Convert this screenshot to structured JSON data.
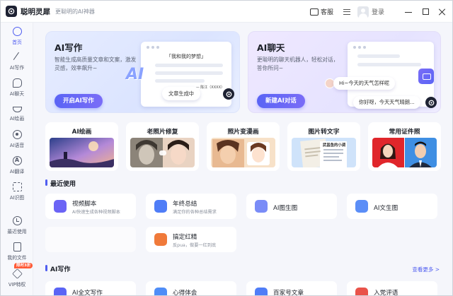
{
  "titlebar": {
    "app_name": "聪明灵犀",
    "slogan": "更聪明的AI神器",
    "service_label": "客服",
    "login_label": "登录"
  },
  "sidebar": {
    "items": [
      {
        "label": "首页",
        "icon": "home-icon",
        "active": true
      },
      {
        "label": "AI写作",
        "icon": "pen-icon"
      },
      {
        "label": "AI聊天",
        "icon": "chat-icon"
      },
      {
        "label": "AI绘画",
        "icon": "brush-icon"
      },
      {
        "label": "AI语音",
        "icon": "voice-icon"
      },
      {
        "label": "AI翻译",
        "icon": "translate-icon"
      },
      {
        "label": "AI识图",
        "icon": "scan-icon"
      },
      {
        "label": "最近使用",
        "icon": "clock-icon"
      },
      {
        "label": "我的文件",
        "icon": "file-icon"
      },
      {
        "label": "VIP特权",
        "icon": "vip-icon"
      }
    ],
    "vip_badge": "限时3折"
  },
  "hero": {
    "write": {
      "title": "AI写作",
      "desc": "智能生成高质量文章和文案，激发灵感，效率飙升~",
      "button": "开启AI写作",
      "mock_title": "「我和我的梦想」",
      "mock_author": "—— 陈江（XXXX）",
      "ai_text": "AI",
      "status": "文章生成中"
    },
    "chat": {
      "title": "AI聊天",
      "desc": "更聪明的聊天机器人，轻松对话，答你所问~",
      "button": "新建AI对话",
      "bubble_user": "Hi~今天的天气怎样呢",
      "bubble_bot": "你好呀，今天天气晴朗..."
    }
  },
  "tools": [
    {
      "label": "AI绘画"
    },
    {
      "label": "老照片修复"
    },
    {
      "label": "照片变漫画"
    },
    {
      "label": "图片转文字",
      "doc_title": "武昌鱼的小调"
    },
    {
      "label": "常用证件照"
    }
  ],
  "recent": {
    "title": "最近使用",
    "items": [
      {
        "title": "视频脚本",
        "sub": "AI快速生成各种视频脚本",
        "color": "#6b64f5"
      },
      {
        "title": "年终总结",
        "sub": "满足你的各种总结需求",
        "color": "#4f7df7"
      },
      {
        "title": "AI图生图",
        "sub": "",
        "color": "#7a8cf7"
      },
      {
        "title": "AI文生图",
        "sub": "",
        "color": "#5b8ef7"
      },
      {
        "title": "",
        "sub": "",
        "color": ""
      },
      {
        "title": "搞定红精",
        "sub": "反pua，做要一红到底",
        "color": "#f07a3a"
      }
    ]
  },
  "ai_writing": {
    "title": "AI写作",
    "more": "查看更多 >",
    "items": [
      {
        "title": "AI全文写作",
        "color": "#5a64f5"
      },
      {
        "title": "心得体会",
        "color": "#4f8df7"
      },
      {
        "title": "百家号文章",
        "color": "#4f7df7"
      },
      {
        "title": "入党评语",
        "color": "#e9534a"
      }
    ]
  }
}
